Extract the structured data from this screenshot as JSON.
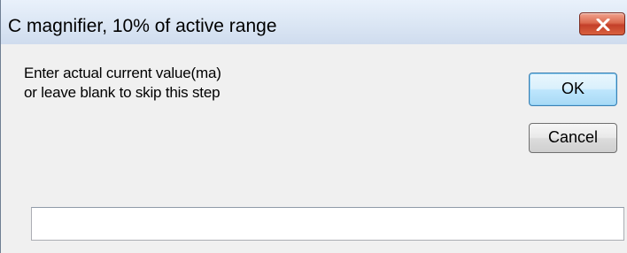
{
  "window": {
    "title": "C magnifier, 10% of active range"
  },
  "prompt": {
    "line1": "Enter actual current value(ma)",
    "line2": "or leave blank to skip this step"
  },
  "buttons": {
    "ok_label": "OK",
    "cancel_label": "Cancel"
  },
  "input": {
    "value": ""
  },
  "icons": {
    "close": "close-icon"
  },
  "colors": {
    "close_button": "#c9472f",
    "ok_button_border": "#3c7fb1",
    "titlebar": "#dbe6f4",
    "client": "#f0f0f0"
  }
}
